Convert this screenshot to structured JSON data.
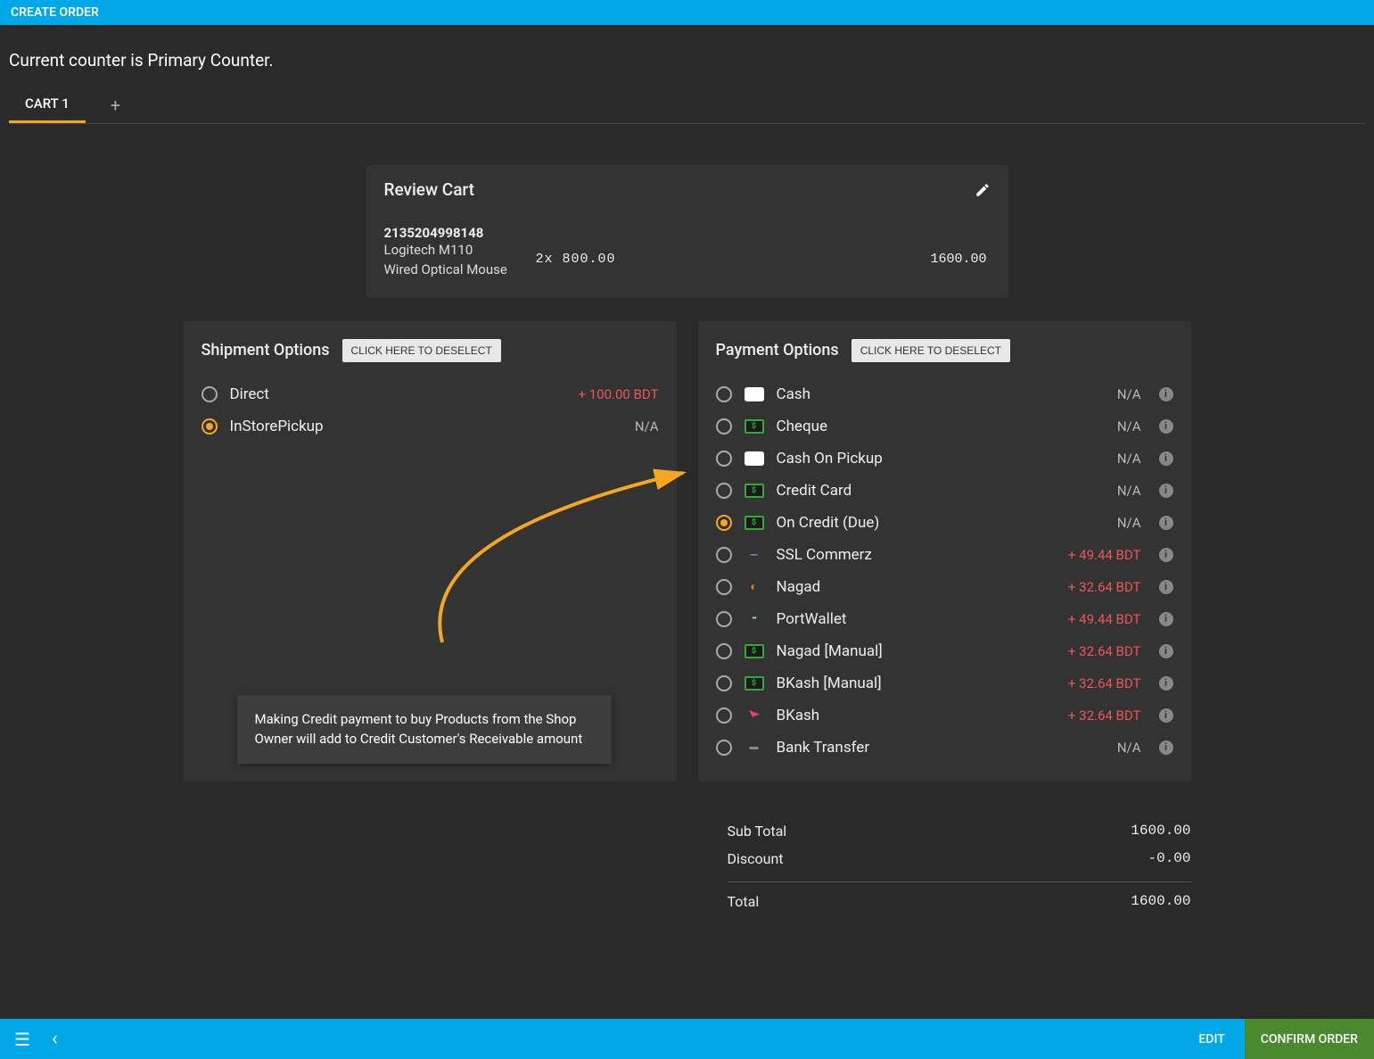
{
  "header": {
    "title": "CREATE ORDER"
  },
  "counter_text": "Current counter is Primary Counter.",
  "tabs": {
    "active": "CART 1"
  },
  "review": {
    "title": "Review Cart",
    "item": {
      "sku": "2135204998148",
      "name": "Logitech M110 Wired Optical Mouse",
      "qty_price": "2x 800.00",
      "total": "1600.00"
    }
  },
  "shipment": {
    "title": "Shipment Options",
    "deselect": "CLICK HERE TO DESELECT",
    "options": [
      {
        "label": "Direct",
        "value": "+ 100.00 BDT",
        "val_class": "neg",
        "selected": false
      },
      {
        "label": "InStorePickup",
        "value": "N/A",
        "val_class": "na",
        "selected": true
      }
    ]
  },
  "payment": {
    "title": "Payment Options",
    "deselect": "CLICK HERE TO DESELECT",
    "options": [
      {
        "label": "Cash",
        "value": "N/A",
        "val_class": "na",
        "icon": "white",
        "selected": false
      },
      {
        "label": "Cheque",
        "value": "N/A",
        "val_class": "na",
        "icon": "green dollar",
        "selected": false
      },
      {
        "label": "Cash On Pickup",
        "value": "N/A",
        "val_class": "na",
        "icon": "white",
        "selected": false
      },
      {
        "label": "Credit Card",
        "value": "N/A",
        "val_class": "na",
        "icon": "green dollar",
        "selected": false
      },
      {
        "label": "On Credit (Due)",
        "value": "N/A",
        "val_class": "na",
        "icon": "green dollar",
        "selected": true
      },
      {
        "label": "SSL Commerz",
        "value": "+ 49.44 BDT",
        "val_class": "neg",
        "icon": "minus",
        "selected": false
      },
      {
        "label": "Nagad",
        "value": "+ 32.64 BDT",
        "val_class": "neg",
        "icon": "ng",
        "selected": false
      },
      {
        "label": "PortWallet",
        "value": "+ 49.44 BDT",
        "val_class": "neg",
        "icon": "pw",
        "selected": false
      },
      {
        "label": "Nagad [Manual]",
        "value": "+ 32.64 BDT",
        "val_class": "neg",
        "icon": "green dollar",
        "selected": false
      },
      {
        "label": "BKash [Manual]",
        "value": "+ 32.64 BDT",
        "val_class": "neg",
        "icon": "green dollar",
        "selected": false
      },
      {
        "label": "BKash",
        "value": "+ 32.64 BDT",
        "val_class": "neg",
        "icon": "bk",
        "selected": false
      },
      {
        "label": "Bank Transfer",
        "value": "N/A",
        "val_class": "na",
        "icon": "bank",
        "selected": false
      }
    ]
  },
  "tooltip": "Making Credit payment to buy Products from the Shop Owner will add to Credit Customer's Receivable amount",
  "totals": {
    "rows": [
      {
        "label": "Sub Total",
        "amount": "1600.00"
      },
      {
        "label": "Discount",
        "amount": "-0.00"
      }
    ],
    "final": {
      "label": "Total",
      "amount": "1600.00"
    }
  },
  "footer": {
    "edit": "EDIT",
    "confirm": "CONFIRM ORDER"
  }
}
